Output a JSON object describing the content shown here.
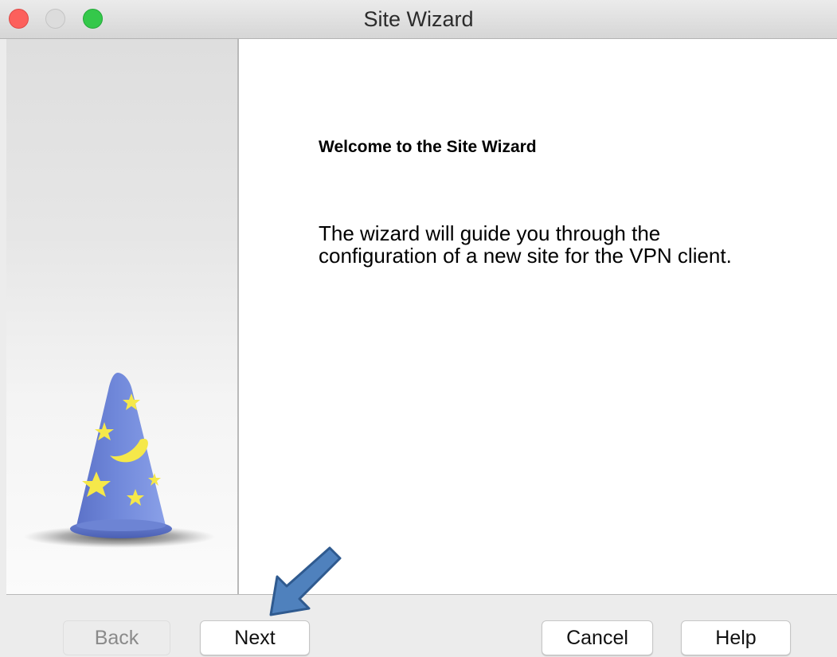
{
  "window": {
    "title": "Site Wizard"
  },
  "wizard": {
    "heading": "Welcome to the Site Wizard",
    "description_lines": [
      "The wizard will guide you through the",
      "configuration of a new site for the VPN client."
    ],
    "illustration": "wizard-hat-icon"
  },
  "buttons": {
    "back": "Back",
    "next": "Next",
    "cancel": "Cancel",
    "help": "Help"
  },
  "annotation": {
    "icon": "arrow-icon",
    "color": "#4f81bd",
    "points_to": "Next"
  },
  "colors": {
    "close": "#fc605c",
    "minimize": "#dcdcdc",
    "zoom": "#34c84a",
    "hat": "#6f86d6",
    "stars": "#f5e84a"
  }
}
